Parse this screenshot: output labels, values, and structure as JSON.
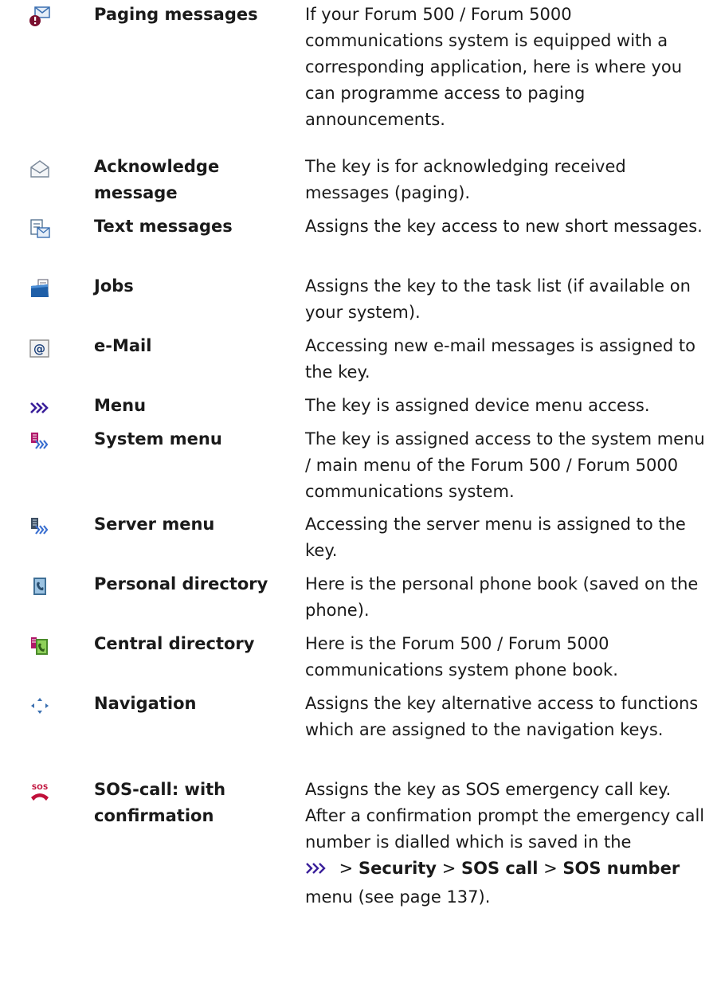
{
  "entries": [
    {
      "icon": "paging-message-icon",
      "name": "Paging messages",
      "desc": "If your Forum 500 / Forum 5000 communications system is equipped with a corresponding application, here is where you can programme access to paging announcements."
    },
    {
      "icon": "acknowledge-envelope-icon",
      "name": "Acknowledge message",
      "desc": "The key is for acknowledging received messages (paging)."
    },
    {
      "icon": "text-message-icon",
      "name": "Text messages",
      "desc": "Assigns the key access to new short messages."
    },
    {
      "icon": "jobs-folder-icon",
      "name": "Jobs",
      "desc": "Assigns the key to the task list (if available on your system)."
    },
    {
      "icon": "email-at-icon",
      "name": "e-Mail",
      "desc": "Accessing new e-mail messages is assigned to the key."
    },
    {
      "icon": "menu-arrows-icon",
      "name": "Menu",
      "desc": "The key is assigned device menu access."
    },
    {
      "icon": "system-menu-icon",
      "name": "System menu",
      "desc": "The key is assigned access to the system menu / main menu of the Forum 500 / Forum 5000 communications system."
    },
    {
      "icon": "server-menu-icon",
      "name": "Server menu",
      "desc": "Accessing the server menu is assigned to the key."
    },
    {
      "icon": "personal-directory-icon",
      "name": "Personal directory",
      "desc": "Here is the personal phone book (saved on the phone)."
    },
    {
      "icon": "central-directory-icon",
      "name": "Central directory",
      "desc": "Here is the Forum 500 / Forum 5000 communications system phone book."
    },
    {
      "icon": "navigation-icon",
      "name": "Navigation",
      "desc": "Assigns the key alternative access to functions which are assigned to the navigation keys."
    },
    {
      "icon": "sos-call-icon",
      "name": "SOS-call: with confirmation",
      "desc": "Assigns the key as SOS emergency call key. After a confirmation prompt the emergency call number is dialled which is saved in the"
    }
  ],
  "sos_path": {
    "icon": "menu-arrows-icon",
    "sep1": " > ",
    "security": "Security",
    "sep2": " > ",
    "sos_call": "SOS call",
    "sep3": " > ",
    "sos_number": "SOS number",
    "tail": "menu (see page 137)."
  }
}
